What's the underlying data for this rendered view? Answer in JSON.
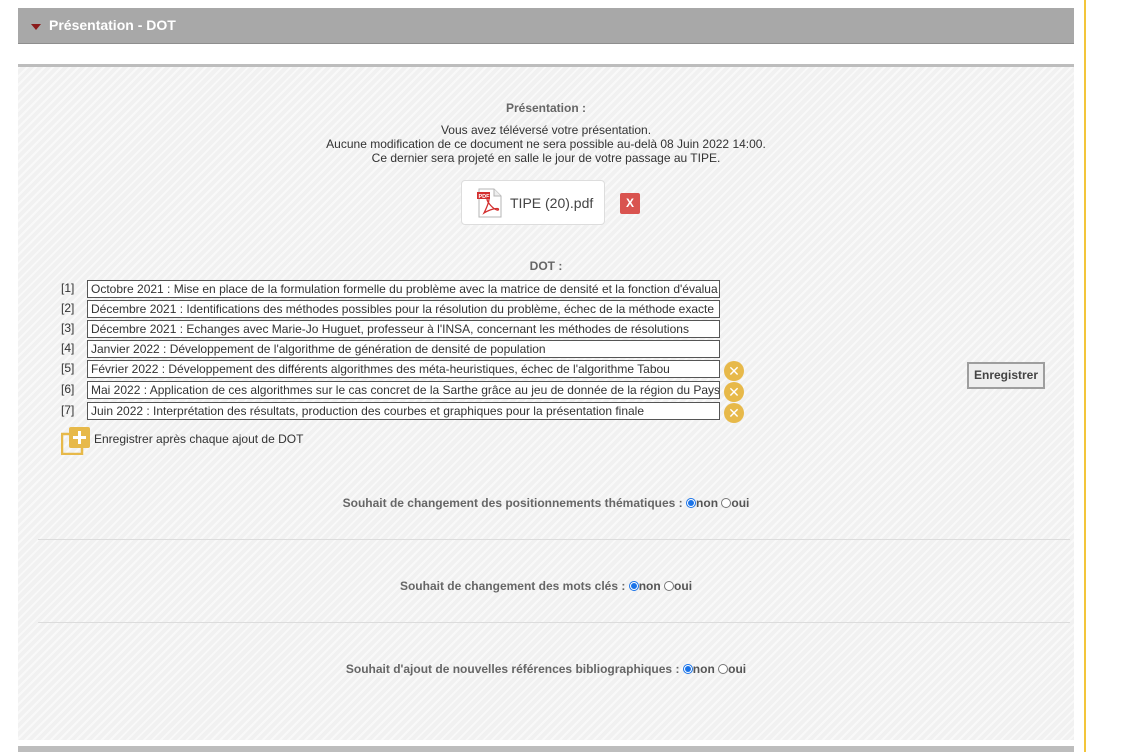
{
  "section": {
    "title": "Présentation - DOT"
  },
  "presentation": {
    "heading": "Présentation :",
    "message_lines": [
      "Vous avez téléversé votre présentation.",
      "Aucune modification de ce document ne sera possible au-delà 08 Juin 2022 14:00.",
      "Ce dernier sera projeté en salle le jour de votre passage au TIPE."
    ],
    "file_name": "TIPE (20).pdf",
    "file_icon": "pdf-file-icon",
    "delete_label": "X"
  },
  "dot": {
    "heading": "DOT :",
    "items": [
      {
        "num": "[1]",
        "text": "Octobre 2021 : Mise en place de la formulation formelle du problème avec la matrice de densité et la fonction d'évalua"
      },
      {
        "num": "[2]",
        "text": "Décembre 2021 : Identifications des méthodes possibles pour la résolution du problème, échec de la méthode exacte"
      },
      {
        "num": "[3]",
        "text": "Décembre 2021 : Echanges avec Marie-Jo Huguet, professeur à l'INSA, concernant les méthodes de résolutions"
      },
      {
        "num": "[4]",
        "text": "Janvier 2022 : Développement de l'algorithme de génération de densité de population"
      },
      {
        "num": "[5]",
        "text": "Février 2022 : Développement des différents algorithmes des méta-heuristiques, échec de l'algorithme Tabou"
      },
      {
        "num": "[6]",
        "text": "Mai 2022 : Application de ces algorithmes sur le cas concret de la Sarthe grâce au jeu de donnée de la région du Pays"
      },
      {
        "num": "[7]",
        "text": "Juin 2022 : Interprétation des résultats, production des courbes et graphiques pour la présentation finale"
      }
    ],
    "remove_icon_label": "✕",
    "add_label": "Enregistrer après chaque ajout de DOT",
    "save_label": "Enregistrer"
  },
  "questions": [
    {
      "label": "Souhait de changement des positionnements thématiques :",
      "selected": "non"
    },
    {
      "label": "Souhait de changement des mots clés :",
      "selected": "non"
    },
    {
      "label": "Souhait d'ajout de nouvelles références bibliographiques :",
      "selected": "non"
    }
  ],
  "options": {
    "non": "non",
    "oui": "oui"
  },
  "colors": {
    "accent_yellow": "#f3c53a",
    "header_gray": "#a8a8a8",
    "delete_red": "#d9534f",
    "radio_blue": "#1a73e8"
  }
}
